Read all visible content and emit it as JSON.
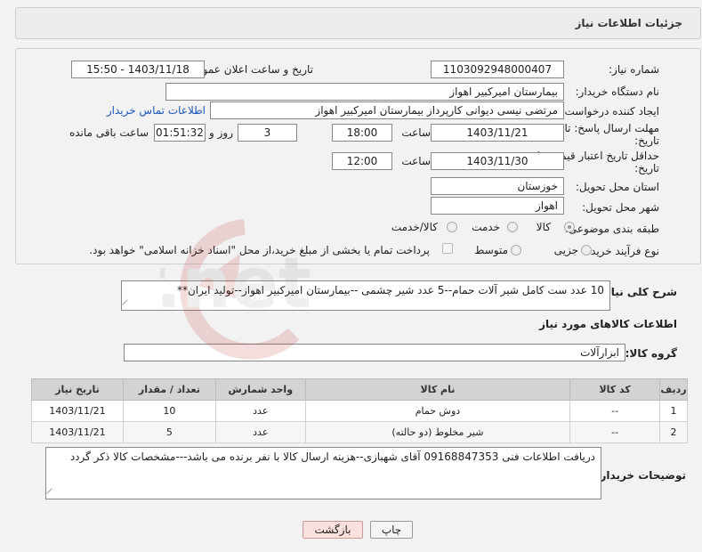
{
  "header": {
    "title": "جزئیات اطلاعات نیاز"
  },
  "fields": {
    "need_number": {
      "label": "شماره نیاز:",
      "value": "1103092948000407"
    },
    "announce_datetime": {
      "label": "تاریخ و ساعت اعلان عمومی:",
      "value": "1403/11/18 - 15:50"
    },
    "buyer_org": {
      "label": "نام دستگاه خریدار:",
      "value": "بیمارستان امیرکبیر اهواز"
    },
    "requester": {
      "label": "ایجاد کننده درخواست:",
      "value": "مرتضی نیسی دیوانی کارپرداز بیمارستان امیرکبیر اهواز",
      "contact_link": "اطلاعات تماس خریدار"
    },
    "reply_deadline": {
      "label_line1": "مهلت ارسال پاسخ: تا",
      "label_line2": "تاریخ:",
      "date": "1403/11/21",
      "time_label": "ساعت",
      "time": "18:00",
      "days": "3",
      "days_label": "روز و",
      "remaining": "01:51:32",
      "remaining_label": "ساعت باقی مانده"
    },
    "price_validity": {
      "label_line1": "حداقل تاریخ اعتبار قیمت: تا",
      "label_line2": "تاریخ:",
      "date": "1403/11/30",
      "time_label": "ساعت",
      "time": "12:00"
    },
    "delivery_province": {
      "label": "استان محل تحویل:",
      "value": "خوزستان"
    },
    "delivery_city": {
      "label": "شهر محل تحویل:",
      "value": "اهواز"
    },
    "category": {
      "label": "طبقه بندی موضوعی:",
      "options": [
        "کالا",
        "خدمت",
        "کالا/خدمت"
      ],
      "selected": "کالا"
    },
    "purchase_process": {
      "label": "نوع فرآیند خرید :",
      "options": [
        "جزیی",
        "متوسط"
      ],
      "payment_note": "پرداخت تمام یا بخشی از مبلغ خرید،از محل \"اسناد خزانه اسلامی\" خواهد بود."
    }
  },
  "summary": {
    "label": "شرح کلی نیاز:",
    "value": "10 عدد ست کامل شیر آلات حمام--5 عدد شیر چشمی --بیمارستان امیرکبیر اهواز--تولید ایران**"
  },
  "goods_section": {
    "title": "اطلاعات کالاهای مورد نیاز",
    "group_label": "گروه کالا:",
    "group_value": "ابزارآلات"
  },
  "table": {
    "headers": [
      "ردیف",
      "کد کالا",
      "نام کالا",
      "واحد شمارش",
      "تعداد / مقدار",
      "تاریخ نیاز"
    ],
    "rows": [
      {
        "row": "1",
        "code": "--",
        "name": "دوش حمام",
        "unit": "عدد",
        "qty": "10",
        "date": "1403/11/21"
      },
      {
        "row": "2",
        "code": "--",
        "name": "شیر مخلوط (دو حالته)",
        "unit": "عدد",
        "qty": "5",
        "date": "1403/11/21"
      }
    ]
  },
  "buyer_notes": {
    "label": "توضیحات خریدار:",
    "value": "دریافت اطلاعات فنی 09168847353 آقای شهبازی--هزینه ارسال کالا با نفر برنده می باشد---مشخصات کالا ذکر گردد"
  },
  "buttons": {
    "print": "چاپ",
    "back": "بازگشت"
  },
  "watermark_text": "AriaTender.net"
}
